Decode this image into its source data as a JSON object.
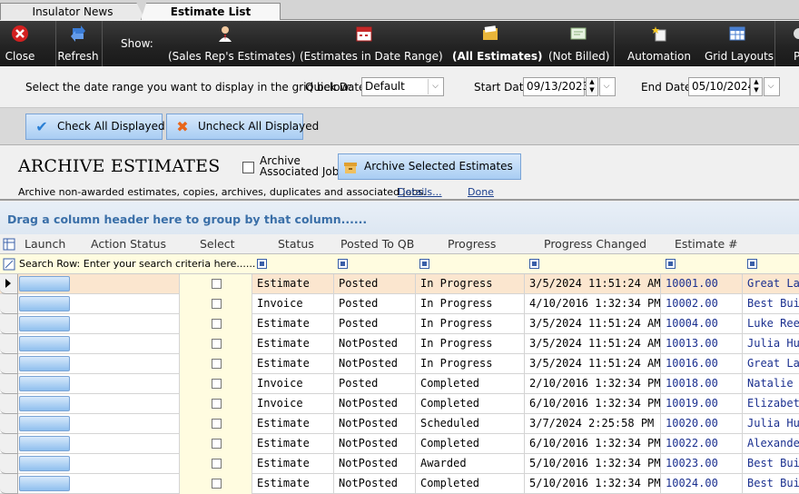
{
  "tabs": [
    "Insulator News",
    "Estimate List"
  ],
  "toolbar": {
    "close": "Close",
    "refresh": "Refresh",
    "show": "Show:",
    "sales_rep": "(Sales Rep's Estimates)",
    "date_range": "(Estimates in Date Range)",
    "all": "(All Estimates)",
    "not_billed": "(Not Billed)",
    "automation": "Automation",
    "grid_layouts": "Grid Layouts",
    "extra": "P"
  },
  "daterow": {
    "prompt": "Select the date range you want to display in the grid below:",
    "quick_label": "Quick Date:",
    "quick_value": "Default",
    "start_label": "Start Date:",
    "start_value": "09/13/2023",
    "end_label": "End Date:",
    "end_value": "05/10/2024"
  },
  "checks": {
    "check_all": "Check All Displayed",
    "uncheck_all": "Uncheck All Displayed"
  },
  "archive": {
    "title": "ARCHIVE ESTIMATES",
    "chk_line1": "Archive",
    "chk_line2": "Associated Job",
    "button": "Archive Selected Estimates",
    "desc": "Archive non-awarded estimates, copies, archives, duplicates and associated jobs.",
    "details": "Details...",
    "done": "Done"
  },
  "grid": {
    "group_hint": "Drag a column header here to group by that column......",
    "headers": [
      "Launch",
      "Action Status",
      "Select",
      "Status",
      "Posted To QB",
      "Progress",
      "Progress Changed",
      "Estimate #"
    ],
    "search_hint": "Search Row: Enter your search criteria here......",
    "rows": [
      {
        "status": "Estimate",
        "posted": "Posted",
        "progress": "In Progress",
        "changed": "3/5/2024 11:51:24 AM",
        "num": "10001.00",
        "cust": "Great Lak"
      },
      {
        "status": "Invoice",
        "posted": "Posted",
        "progress": "In Progress",
        "changed": "4/10/2016 1:32:34 PM",
        "num": "10002.00",
        "cust": "Best Build"
      },
      {
        "status": "Estimate",
        "posted": "Posted",
        "progress": "In Progress",
        "changed": "3/5/2024 11:51:24 AM",
        "num": "10004.00",
        "cust": "Luke Reed"
      },
      {
        "status": "Estimate",
        "posted": "NotPosted",
        "progress": "In Progress",
        "changed": "3/5/2024 11:51:24 AM",
        "num": "10013.00",
        "cust": "Julia Hunt"
      },
      {
        "status": "Estimate",
        "posted": "NotPosted",
        "progress": "In Progress",
        "changed": "3/5/2024 11:51:24 AM",
        "num": "10016.00",
        "cust": "Great Lak"
      },
      {
        "status": "Invoice",
        "posted": "Posted",
        "progress": "Completed",
        "changed": "2/10/2016 1:32:34 PM",
        "num": "10018.00",
        "cust": "Natalie Da"
      },
      {
        "status": "Invoice",
        "posted": "NotPosted",
        "progress": "Completed",
        "changed": "6/10/2016 1:32:34 PM",
        "num": "10019.00",
        "cust": "Elizabeth"
      },
      {
        "status": "Estimate",
        "posted": "NotPosted",
        "progress": "Scheduled",
        "changed": "3/7/2024 2:25:58 PM",
        "num": "10020.00",
        "cust": "Julia Hunt"
      },
      {
        "status": "Estimate",
        "posted": "NotPosted",
        "progress": "Completed",
        "changed": "6/10/2016 1:32:34 PM",
        "num": "10022.00",
        "cust": "Alexander"
      },
      {
        "status": "Estimate",
        "posted": "NotPosted",
        "progress": "Awarded",
        "changed": "5/10/2016 1:32:34 PM",
        "num": "10023.00",
        "cust": "Best Build"
      },
      {
        "status": "Estimate",
        "posted": "NotPosted",
        "progress": "Completed",
        "changed": "5/10/2016 1:32:34 PM",
        "num": "10024.00",
        "cust": "Best Build"
      }
    ]
  }
}
